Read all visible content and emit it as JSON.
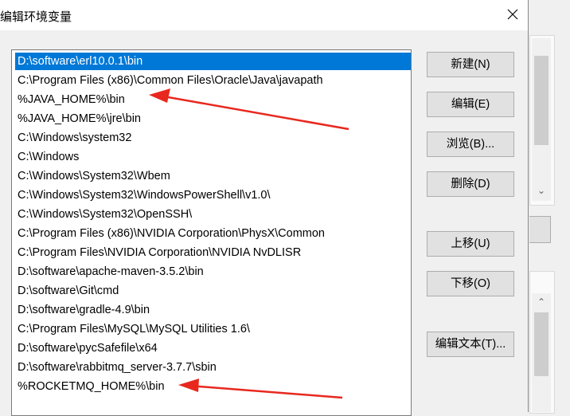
{
  "dialog": {
    "title": "编辑环境变量",
    "close_glyph": "✕"
  },
  "paths": [
    "D:\\software\\erl10.0.1\\bin",
    "C:\\Program Files (x86)\\Common Files\\Oracle\\Java\\javapath",
    "%JAVA_HOME%\\bin",
    "%JAVA_HOME%\\jre\\bin",
    "C:\\Windows\\system32",
    "C:\\Windows",
    "C:\\Windows\\System32\\Wbem",
    "C:\\Windows\\System32\\WindowsPowerShell\\v1.0\\",
    "C:\\Windows\\System32\\OpenSSH\\",
    "C:\\Program Files (x86)\\NVIDIA Corporation\\PhysX\\Common",
    "C:\\Program Files\\NVIDIA Corporation\\NVIDIA NvDLISR",
    "D:\\software\\apache-maven-3.5.2\\bin",
    "D:\\software\\Git\\cmd",
    "D:\\software\\gradle-4.9\\bin",
    "C:\\Program Files\\MySQL\\MySQL Utilities 1.6\\",
    "D:\\software\\pycSafefile\\x64",
    "D:\\software\\rabbitmq_server-3.7.7\\sbin",
    "%ROCKETMQ_HOME%\\bin"
  ],
  "selected_index": 0,
  "buttons": {
    "new": "新建(N)",
    "edit": "编辑(E)",
    "browse": "浏览(B)...",
    "delete": "删除(D)",
    "move_up": "上移(U)",
    "move_down": "下移(O)",
    "edit_text": "编辑文本(T)..."
  },
  "background_window": {
    "scroll_up_glyph": "⌃",
    "scroll_down_glyph": "⌄"
  },
  "colors": {
    "selection": "#0078d7",
    "annotation_arrow": "#e8281e"
  }
}
